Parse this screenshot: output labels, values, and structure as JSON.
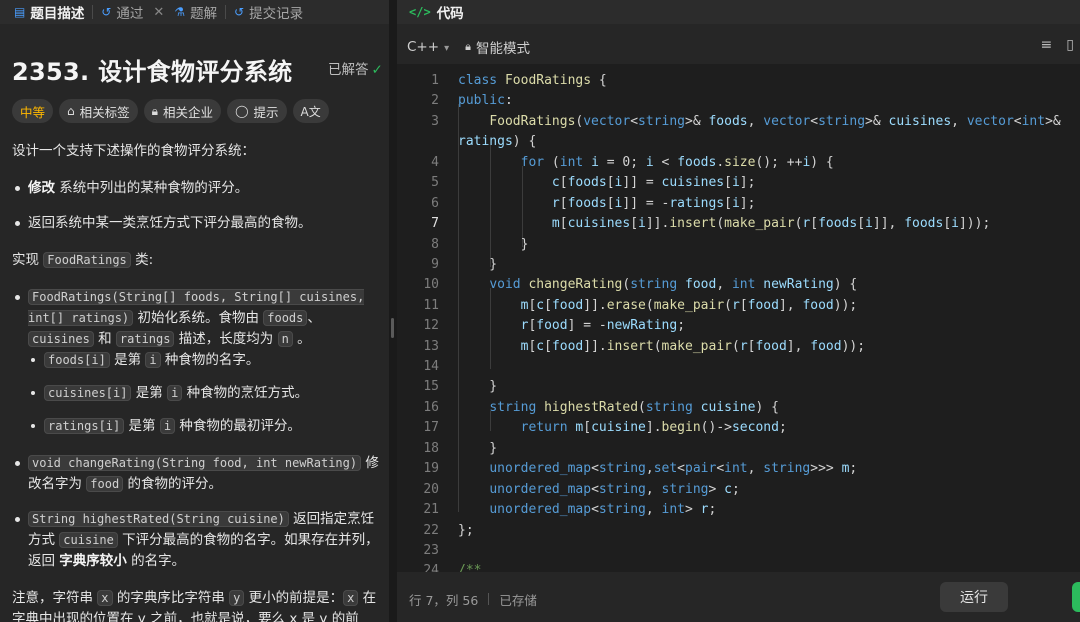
{
  "left_tabs": [
    {
      "label": "题目描述",
      "icon": "document-icon",
      "active": true
    },
    {
      "label": "通过",
      "icon": "history-icon",
      "active": false
    },
    {
      "label": "题解",
      "icon": "flask-icon",
      "active": false
    },
    {
      "label": "提交记录",
      "icon": "history-icon",
      "active": false
    }
  ],
  "problem": {
    "title": "2353. 设计食物评分系统",
    "status": "已解答",
    "tags": [
      {
        "label": "中等",
        "kind": "difficulty"
      },
      {
        "label": "相关标签",
        "icon": "tag-icon"
      },
      {
        "label": "相关企业",
        "icon": "lock-icon"
      },
      {
        "label": "提示",
        "icon": "lightbulb-icon"
      },
      {
        "label": "A文",
        "icon": "translate-icon"
      }
    ],
    "intro": "设计一个支持下述操作的食物评分系统：",
    "b1_bold": "修改",
    "b1_rest": " 系统中列出的某种食物的评分。",
    "b2": "返回系统中某一类烹饪方式下评分最高的食物。",
    "impl_pre": "实现 ",
    "impl_code": "FoodRatings",
    "impl_post": " 类:",
    "c1_code": "FoodRatings(String[] foods, String[] cuisines, int[] ratings)",
    "c1_text": " 初始化系统。食物由 ",
    "c1_code2": "foods",
    "c1_text2": "、",
    "c1_code3": "cuisines",
    "c1_text3": " 和 ",
    "c1_code4": "ratings",
    "c1_text4": " 描述，长度均为 ",
    "c1_code5": "n",
    "c1_text5": " 。",
    "s1_code": "foods[i]",
    "s1_text": " 是第 ",
    "s1_i": "i",
    "s1_rest": " 种食物的名字。",
    "s2_code": "cuisines[i]",
    "s2_text": " 是第 ",
    "s2_i": "i",
    "s2_rest": " 种食物的烹饪方式。",
    "s3_code": "ratings[i]",
    "s3_text": " 是第 ",
    "s3_i": "i",
    "s3_rest": " 种食物的最初评分。",
    "c2_code": "void changeRating(String food, int newRating)",
    "c2_text": " 修改名字为 ",
    "c2_code2": "food",
    "c2_rest": " 的食物的评分。",
    "c3_code": "String highestRated(String cuisine)",
    "c3_text": " 返回指定烹饪方式 ",
    "c3_code2": "cuisine",
    "c3_text2": " 下评分最高的食物的名字。如果存在并列，返回 ",
    "c3_bold": "字典序较小",
    "c3_rest": " 的名字。",
    "note_pre": "注意，字符串 ",
    "note_x": "x",
    "note_mid": " 的字典序比字符串 ",
    "note_y": "y",
    "note_mid2": " 更小的前提是：",
    "note_x2": "x",
    "note_end": " 在字典中出现的位置在 y 之前，也就是说，要么 x 是 y 的前"
  },
  "editor": {
    "panel_title": "代码",
    "language": "C++",
    "mode": "智能模式",
    "status_pos": "行 7，列 56",
    "status_saved": "已存储",
    "run_label": "运行"
  }
}
